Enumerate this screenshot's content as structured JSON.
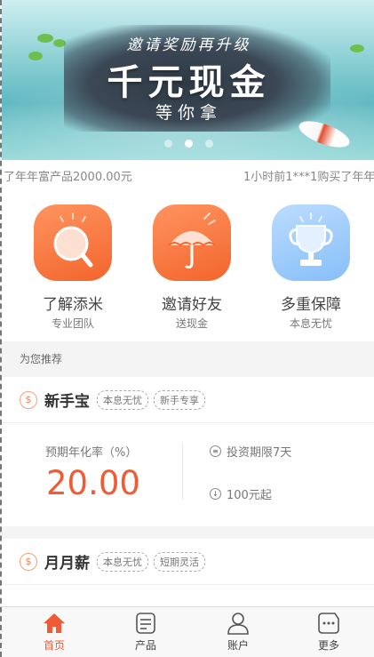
{
  "banner": {
    "subtitle": "邀请奖励再升级",
    "headline": "千元现金",
    "tagline": "等你拿",
    "dots": 3,
    "active_dot": 1
  },
  "marquee": {
    "left_text": "了年年富产品2000.00元",
    "right_text": "1小时前1***1购买了年年"
  },
  "features": [
    {
      "title": "了解添米",
      "subtitle": "专业团队",
      "icon": "magnifier-icon",
      "color": "#f2652c"
    },
    {
      "title": "邀请好友",
      "subtitle": "送现金",
      "icon": "umbrella-icon",
      "color": "#f2652c"
    },
    {
      "title": "多重保障",
      "subtitle": "本息无忧",
      "icon": "trophy-icon",
      "color": "#86bff8"
    }
  ],
  "section_label": "为您推荐",
  "products": [
    {
      "name": "新手宝",
      "tags": [
        "本息无忧",
        "新手专享"
      ],
      "rate_label": "预期年化率（%）",
      "rate": "20.00",
      "term": "投资期限7天",
      "min_amount": "100元起"
    },
    {
      "name": "月月薪",
      "tags": [
        "本息无忧",
        "短期灵活"
      ]
    }
  ],
  "tabbar": [
    {
      "label": "首页",
      "icon": "home-icon",
      "active": true
    },
    {
      "label": "产品",
      "icon": "document-icon",
      "active": false
    },
    {
      "label": "账户",
      "icon": "user-icon",
      "active": false
    },
    {
      "label": "更多",
      "icon": "more-icon",
      "active": false
    }
  ],
  "colors": {
    "accent": "#ef5b35",
    "feature_orange": "#f2652c",
    "feature_blue": "#86bff8"
  }
}
